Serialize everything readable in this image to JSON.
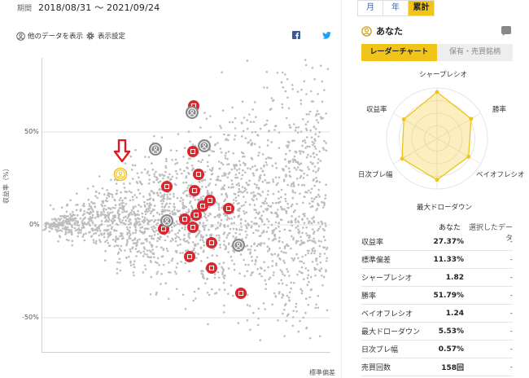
{
  "period": {
    "label": "期間",
    "value": "2018/08/31 ～ 2021/09/24"
  },
  "range_tabs": [
    {
      "label": "月",
      "active": false
    },
    {
      "label": "年",
      "active": false
    },
    {
      "label": "累計",
      "active": true
    }
  ],
  "toolbar": {
    "show_others_label": "他のデータを表示",
    "settings_label": "表示設定"
  },
  "chart": {
    "y_ticks": [
      "50%",
      "0%",
      "-50%"
    ],
    "y_label": "収益率（%）",
    "x_label": "標準偏差"
  },
  "profile": {
    "name": "あなた"
  },
  "sub_tabs": [
    {
      "label": "レーダーチャート",
      "active": true
    },
    {
      "label": "保有・売買銘柄",
      "active": false
    }
  ],
  "radar": {
    "axes": [
      "シャープレシオ",
      "勝率",
      "ベイオフレシオ",
      "最大ドローダウン",
      "日次ブレ幅",
      "収益率"
    ]
  },
  "table": {
    "headers": [
      "",
      "あなた",
      "選択したデータ"
    ],
    "rows": [
      {
        "label": "収益率",
        "value": "27.37%",
        "selected": "-"
      },
      {
        "label": "標準偏差",
        "value": "11.33%",
        "selected": "-"
      },
      {
        "label": "シャープレシオ",
        "value": "1.82",
        "selected": "-"
      },
      {
        "label": "勝率",
        "value": "51.79%",
        "selected": "-"
      },
      {
        "label": "ベイオフレシオ",
        "value": "1.24",
        "selected": "-"
      },
      {
        "label": "最大ドローダウン",
        "value": "5.53%",
        "selected": "-"
      },
      {
        "label": "日次ブレ幅",
        "value": "0.57%",
        "selected": "-"
      },
      {
        "label": "売買回数",
        "value": "158回",
        "selected": "-"
      }
    ]
  },
  "colors": {
    "accent": "#f0c419",
    "marker_red": "#d8282f",
    "marker_gray": "#888888",
    "arrow": "#e8171f",
    "twitter": "#1da1f2",
    "facebook": "#3b5998"
  },
  "icons": [
    "user-icon",
    "gear-icon",
    "facebook-icon",
    "twitter-icon",
    "comment-icon",
    "down-arrow-icon"
  ]
}
